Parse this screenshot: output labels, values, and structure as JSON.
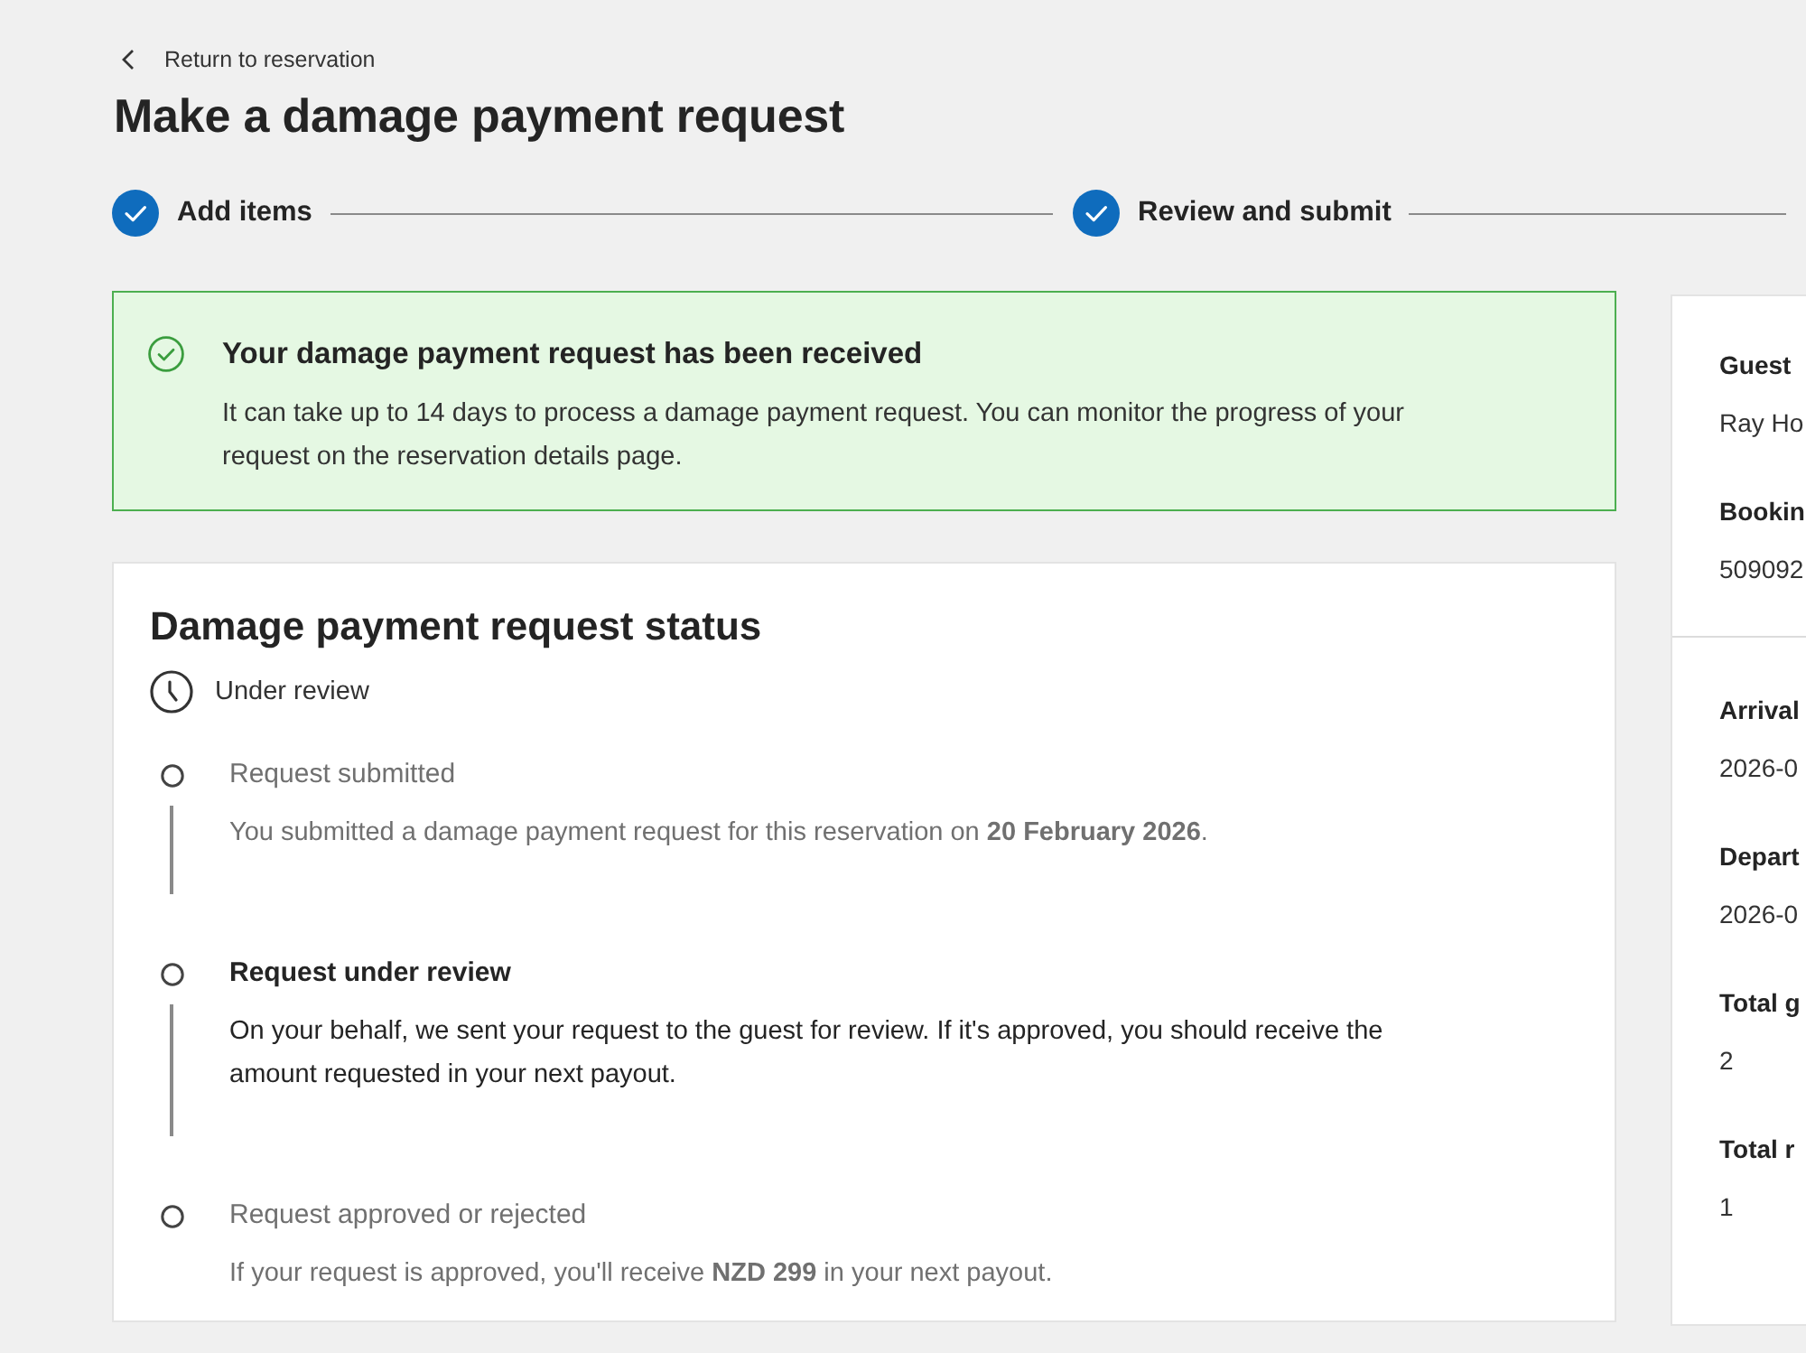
{
  "back_link": {
    "label": "Return to reservation"
  },
  "title": "Make a damage payment request",
  "steps": [
    {
      "label": "Add items",
      "completed": true
    },
    {
      "label": "Review and submit",
      "completed": true
    }
  ],
  "banner": {
    "kind": "success",
    "title": "Your damage payment request has been received",
    "message": "It can take up to 14 days to process a damage payment request. You can monitor the progress of your request on the reservation details page."
  },
  "status_card": {
    "title": "Damage payment request status",
    "status": "Under review",
    "timeline": [
      {
        "title": "Request submitted",
        "description": "You submitted a damage payment request for this reservation on **20 February 2026**.",
        "active": false
      },
      {
        "title": "Request under review",
        "description": "On your behalf, we sent your request to the guest for review. If it's approved, you should receive the amount requested in your next payout.",
        "active": true
      },
      {
        "title": "Request approved or rejected",
        "description": "If your request is approved, you'll receive **NZD 299** in your next payout.",
        "active": false
      }
    ]
  },
  "details_panel": {
    "sections": [
      {
        "fields": [
          {
            "label": "Guest",
            "value": "Ray Ho"
          },
          {
            "label": "Bookin",
            "value": "509092"
          }
        ]
      },
      {
        "fields": [
          {
            "label": "Arrival",
            "value": "2026-0"
          },
          {
            "label": "Depart",
            "value": "2026-0"
          },
          {
            "label": "Total g",
            "value": "2"
          },
          {
            "label": "Total r",
            "value": "1"
          }
        ]
      }
    ]
  }
}
